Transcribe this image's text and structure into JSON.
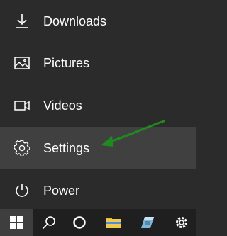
{
  "menu": {
    "items": [
      {
        "label": "Downloads",
        "icon": "download-icon"
      },
      {
        "label": "Pictures",
        "icon": "pictures-icon"
      },
      {
        "label": "Videos",
        "icon": "videos-icon"
      },
      {
        "label": "Settings",
        "icon": "settings-icon",
        "state": "hovered"
      },
      {
        "label": "Power",
        "icon": "power-icon"
      }
    ]
  },
  "annotation": {
    "type": "arrow",
    "color": "#1f8a1f",
    "points_to": "Settings"
  },
  "taskbar": {
    "items": [
      "windows-start-icon",
      "search-icon",
      "cortana-icon",
      "file-explorer-icon",
      "notes-app-icon",
      "settings-gear-icon"
    ]
  },
  "colors": {
    "menu_bg": "#2b2b2b",
    "hover_bg": "#404040",
    "taskbar_bg": "#1f1f1f",
    "text": "#ffffff"
  }
}
